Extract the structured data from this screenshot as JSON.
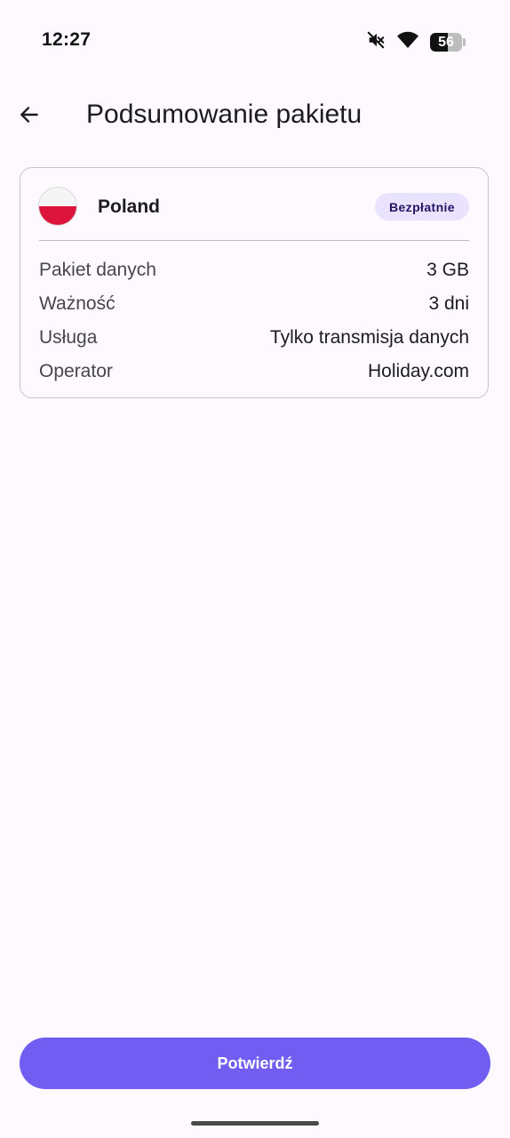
{
  "status_bar": {
    "time": "12:27",
    "battery_level": "56",
    "battery_fraction": 0.56,
    "icons": [
      "mute-icon",
      "wifi-icon",
      "battery-icon"
    ]
  },
  "app_bar": {
    "back_icon": "arrow-left-icon",
    "title": "Podsumowanie pakietu"
  },
  "package_card": {
    "country": "Poland",
    "flag_colors": [
      "#f5f5f5",
      "#dc143c"
    ],
    "price_badge": "Bezpłatnie",
    "details": [
      {
        "label": "Pakiet danych",
        "value": "3 GB"
      },
      {
        "label": "Ważność",
        "value": "3 dni"
      },
      {
        "label": "Usługa",
        "value": "Tylko transmisja danych"
      },
      {
        "label": "Operator",
        "value": "Holiday.com"
      }
    ]
  },
  "confirm_button": {
    "label": "Potwierdź"
  },
  "colors": {
    "accent": "#715df2",
    "badge_background": "#e9e3ff",
    "badge_text": "#211463",
    "background": "#fdf9ff"
  }
}
